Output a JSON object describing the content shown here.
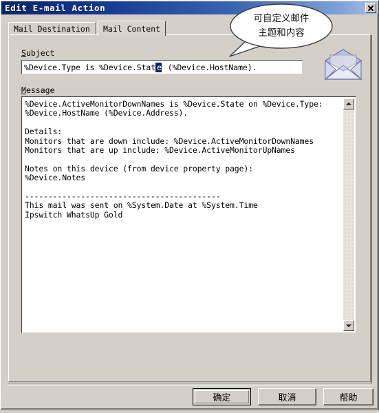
{
  "window": {
    "title": "Edit E-mail Action",
    "close_icon": "close-icon"
  },
  "tabs": [
    {
      "label": "Mail Destination",
      "active": false
    },
    {
      "label": "Mail Content",
      "active": true
    }
  ],
  "form": {
    "subject": {
      "label": "Subject",
      "label_accel": "S",
      "label_rest": "ubject",
      "value_before_selection": "%Device.Type is %Device.Stat",
      "selected_text": "e",
      "value_after_selection": " (%Device.HostName)."
    },
    "message": {
      "label": "Message",
      "label_accel": "M",
      "label_rest": "essage",
      "value": "%Device.ActiveMonitorDownNames is %Device.State on %Device.Type:\n%Device.HostName (%Device.Address).\n\nDetails:\nMonitors that are down include: %Device.ActiveMonitorDownNames\nMonitors that are up include: %Device.ActiveMonitorUpNames\n\nNotes on this device (from device property page):\n%Device.Notes\n\n------------------------------------------\nThis mail was sent on %System.Date at %System.Time\nIpswitch WhatsUp Gold"
    }
  },
  "scrollbar": {
    "up_icon": "scroll-up-arrow-icon",
    "down_icon": "scroll-down-arrow-icon"
  },
  "icons": {
    "envelope": "envelope-icon"
  },
  "callout": {
    "line1": "可自定义邮件",
    "line2": "主题和内容"
  },
  "buttons": {
    "ok": "确定",
    "cancel": "取消",
    "help": "帮助"
  },
  "colors": {
    "face": "#d4d0c8",
    "title_dark": "#0a246a",
    "title_light": "#a6c0e8",
    "selection": "#0a246a",
    "field_bg": "#ffffff"
  }
}
